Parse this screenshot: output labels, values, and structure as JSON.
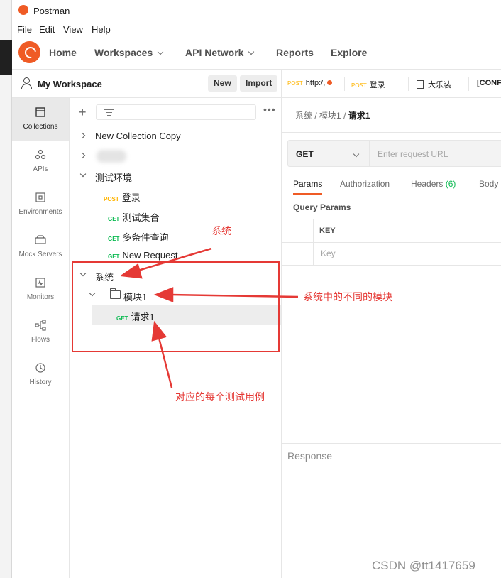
{
  "window": {
    "title": "Postman"
  },
  "menu": [
    "File",
    "Edit",
    "View",
    "Help"
  ],
  "header": {
    "nav": [
      {
        "label": "Home",
        "dropdown": false
      },
      {
        "label": "Workspaces",
        "dropdown": true
      },
      {
        "label": "API Network",
        "dropdown": true
      },
      {
        "label": "Reports",
        "dropdown": false
      },
      {
        "label": "Explore",
        "dropdown": false
      }
    ]
  },
  "workspace": {
    "name": "My Workspace",
    "new_label": "New",
    "import_label": "Import"
  },
  "sidebar": {
    "items": [
      {
        "label": "Collections",
        "icon": "collections-icon",
        "active": true
      },
      {
        "label": "APIs",
        "icon": "apis-icon"
      },
      {
        "label": "Environments",
        "icon": "environments-icon"
      },
      {
        "label": "Mock Servers",
        "icon": "mock-servers-icon"
      },
      {
        "label": "Monitors",
        "icon": "monitors-icon"
      },
      {
        "label": "Flows",
        "icon": "flows-icon"
      },
      {
        "label": "History",
        "icon": "history-icon"
      }
    ]
  },
  "tree": {
    "items": [
      {
        "label": "New Collection Copy"
      },
      {
        "label": "测试环境"
      },
      {
        "method": "POST",
        "label": "登录"
      },
      {
        "method": "GET",
        "label": "测试集合"
      },
      {
        "method": "GET",
        "label": "多条件查询"
      },
      {
        "method": "GET",
        "label": "New Request"
      },
      {
        "label": "系统"
      },
      {
        "label": "模块1"
      },
      {
        "method": "GET",
        "label": "请求1"
      }
    ]
  },
  "tabs": [
    {
      "method": "POST",
      "label": "http:/,"
    },
    {
      "method": "POST",
      "label": "登录"
    },
    {
      "label": "大乐装"
    },
    {
      "label": "[CONF"
    }
  ],
  "request": {
    "breadcrumb": [
      "系统",
      "模块1",
      "请求1"
    ],
    "method": "GET",
    "url_placeholder": "Enter request URL",
    "param_tabs": [
      {
        "label": "Params",
        "active": true
      },
      {
        "label": "Authorization"
      },
      {
        "label": "Headers",
        "count": "(6)"
      },
      {
        "label": "Body"
      }
    ],
    "query_params_title": "Query Params",
    "key_header": "KEY",
    "key_placeholder": "Key",
    "response_label": "Response"
  },
  "annotations": {
    "system": "系统",
    "modules": "系统中的不同的模块",
    "cases": "对应的每个测试用例",
    "color": "#e53935"
  },
  "watermark": "CSDN @tt1417659",
  "colors": {
    "accent": "#ef5b25",
    "get": "#0cbb52",
    "post": "#ffb400"
  }
}
